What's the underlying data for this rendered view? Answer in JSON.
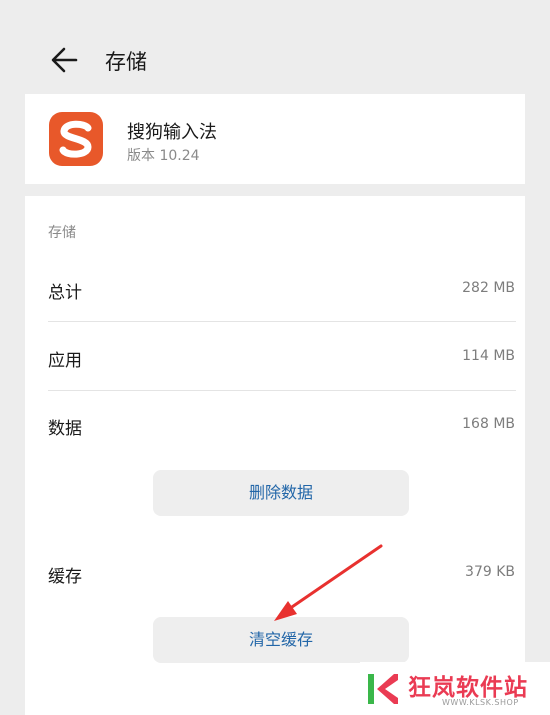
{
  "header": {
    "title": "存储"
  },
  "app": {
    "name": "搜狗输入法",
    "version": "版本 10.24"
  },
  "storage": {
    "section_label": "存储",
    "rows": [
      {
        "label": "总计",
        "value": "282 MB"
      },
      {
        "label": "应用",
        "value": "114 MB"
      },
      {
        "label": "数据",
        "value": "168 MB"
      }
    ],
    "delete_data_button": "删除数据",
    "cache": {
      "label": "缓存",
      "value": "379 KB"
    },
    "clear_cache_button": "清空缓存"
  },
  "watermark": {
    "text": "狂岚软件站",
    "url": "WWW.KLSK.SHOP"
  },
  "colors": {
    "background": "#ededed",
    "button_text": "#2266a8",
    "app_icon": "#e8582a",
    "arrow": "#e8312f",
    "watermark_text": "#ea3b53"
  },
  "icons": {
    "back": "arrow-left-icon",
    "app": "sogou-input-app-icon",
    "watermark_logo": "klsk-logo"
  }
}
